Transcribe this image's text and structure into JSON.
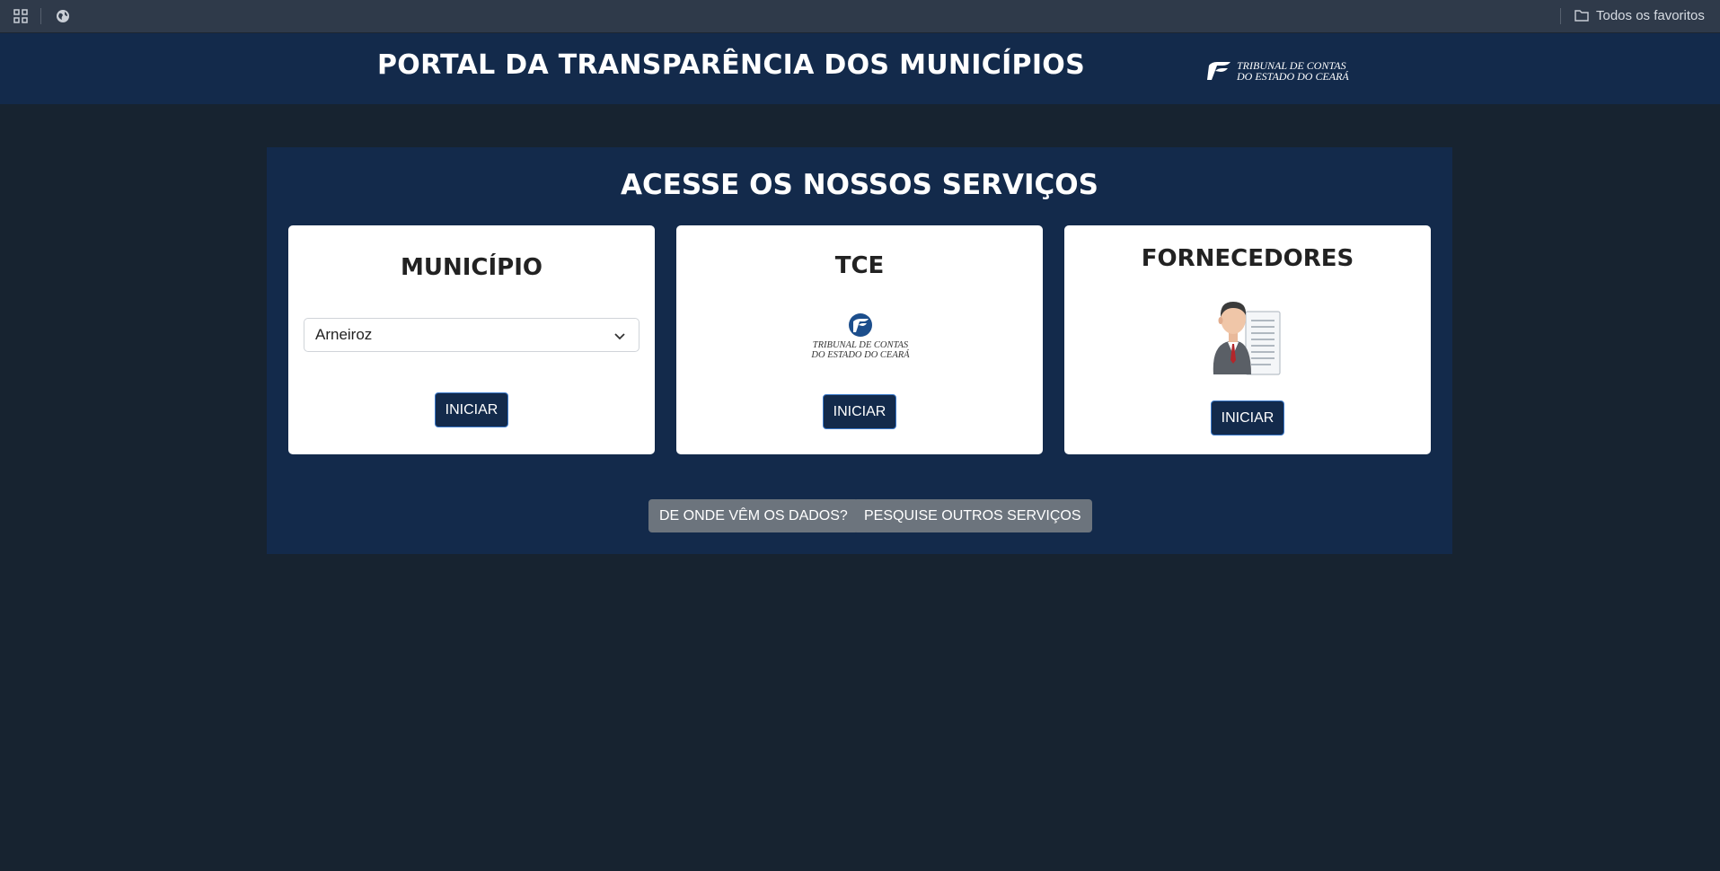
{
  "bookmarks": {
    "all_bookmarks_label": "Todos os favoritos"
  },
  "header": {
    "title": "PORTAL DA TRANSPARÊNCIA DOS MUNICÍPIOS",
    "logo_line1": "TRIBUNAL DE CONTAS",
    "logo_line2": "DO ESTADO DO CEARÁ"
  },
  "services": {
    "title": "ACESSE OS NOSSOS SERVIÇOS",
    "cards": {
      "municipio": {
        "title": "MUNICÍPIO",
        "selected_value": "Arneiroz",
        "button_label": "INICIAR"
      },
      "tce": {
        "title": "TCE",
        "logo_line1": "TRIBUNAL DE CONTAS",
        "logo_line2": "DO ESTADO DO CEARÁ",
        "button_label": "INICIAR"
      },
      "fornecedores": {
        "title": "FORNECEDORES",
        "button_label": "INICIAR"
      }
    },
    "footer_buttons": {
      "dados_label": "DE ONDE VÊM OS DADOS?",
      "outros_label": "PESQUISE OUTROS SERVIÇOS"
    }
  },
  "colors": {
    "page_bg": "#172330",
    "header_bg": "#132a4b",
    "button_primary": "#132a4b",
    "button_secondary": "#6c747d"
  }
}
